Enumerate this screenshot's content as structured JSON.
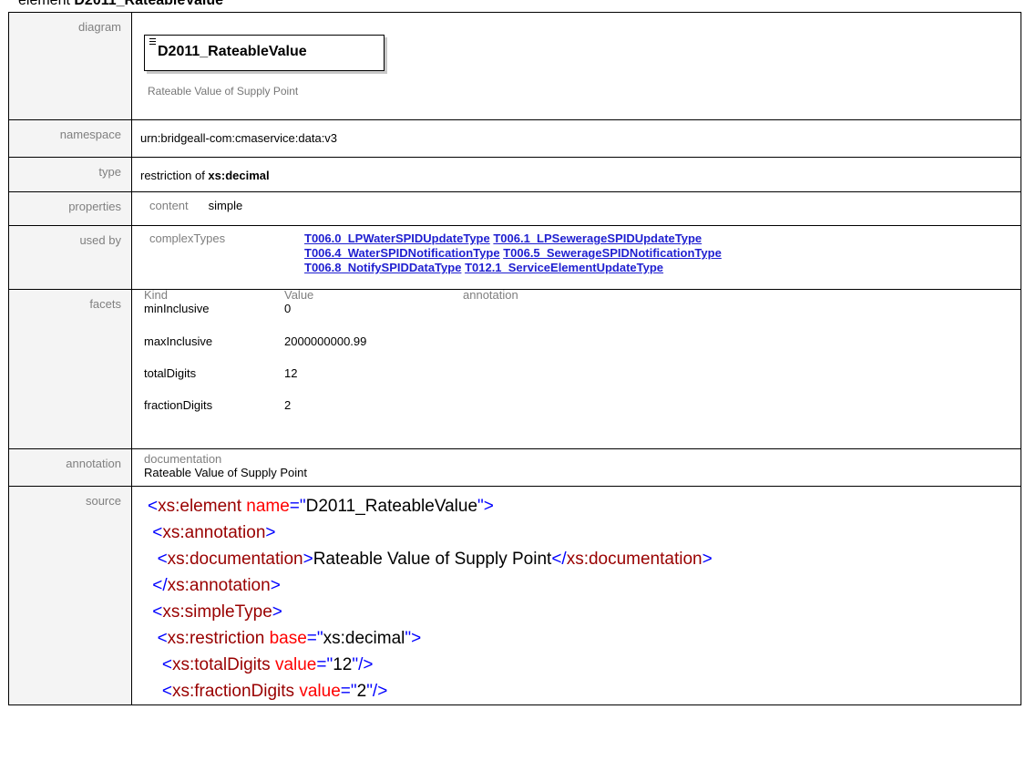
{
  "heading": {
    "prefix": "element ",
    "name": "D2011_RateableValue"
  },
  "labels": {
    "diagram": "diagram",
    "namespace": "namespace",
    "type": "type",
    "properties": "properties",
    "used_by": "used by",
    "facets": "facets",
    "annotation": "annotation",
    "source": "source"
  },
  "diagram": {
    "element_name": "D2011_RateableValue",
    "description": "Rateable Value of Supply Point"
  },
  "namespace": "urn:bridgeall-com:cmaservice:data:v3",
  "type": {
    "prefix": "restriction of ",
    "base": "xs:decimal"
  },
  "properties": {
    "key": "content",
    "value": "simple"
  },
  "used_by": {
    "category": "complexTypes",
    "links": [
      "T006.0_LPWaterSPIDUpdateType",
      "T006.1_LPSewerageSPIDUpdateType",
      "T006.4_WaterSPIDNotificationType",
      "T006.5_SewerageSPIDNotificationType",
      "T006.8_NotifySPIDDataType",
      "T012.1_ServiceElementUpdateType"
    ]
  },
  "facets": {
    "headers": [
      "Kind",
      "Value",
      "annotation"
    ],
    "rows": [
      {
        "kind": "minInclusive",
        "value": "0"
      },
      {
        "kind": "maxInclusive",
        "value": "2000000000.99"
      },
      {
        "kind": "totalDigits",
        "value": "12"
      },
      {
        "kind": "fractionDigits",
        "value": "2"
      }
    ]
  },
  "annotation": {
    "category": "documentation",
    "text": "Rateable Value of Supply Point"
  },
  "source": {
    "element_name": "D2011_RateableValue",
    "documentation": "Rateable Value of Supply Point",
    "restriction_base": "xs:decimal",
    "total_digits": "12",
    "fraction_digits": "2"
  },
  "colors": {
    "tag_bracket": "#0000ff",
    "tag_name": "#990000",
    "attr_name": "#ff0000",
    "link": "#1f1fd0",
    "label_bg": "#f4f4f4"
  }
}
